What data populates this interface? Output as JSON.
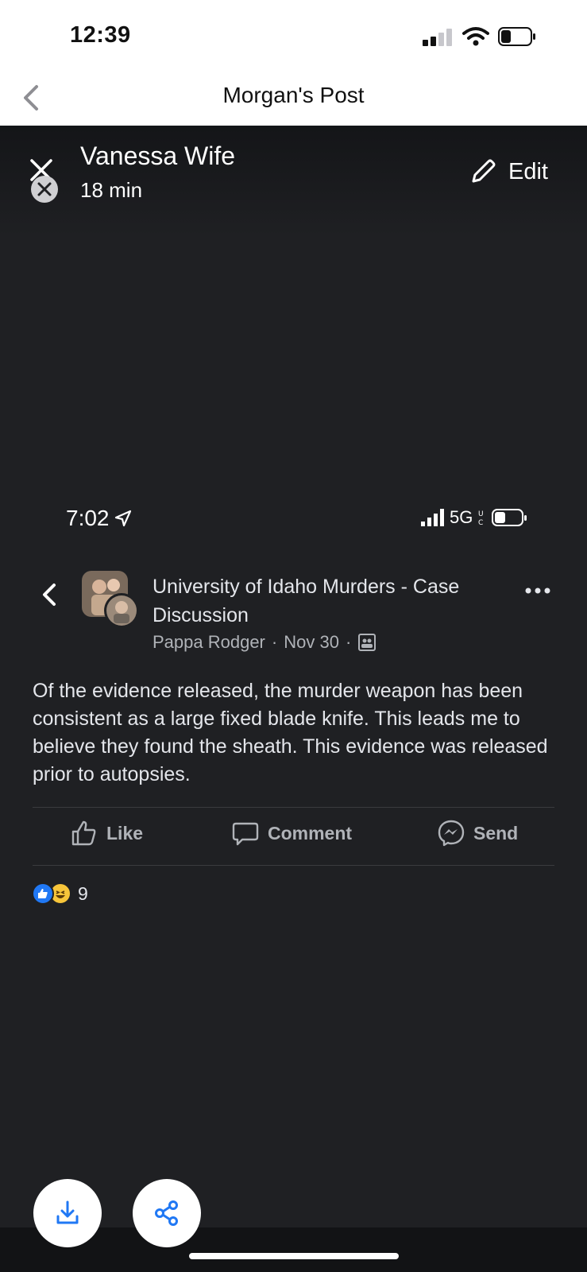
{
  "status_bar": {
    "time": "12:39"
  },
  "nav": {
    "title": "Morgan's Post"
  },
  "story": {
    "author": "Vanessa Wife",
    "time": "18 min",
    "edit_label": "Edit"
  },
  "screenshot": {
    "status": {
      "time": "7:02",
      "network": "5G"
    },
    "post": {
      "group_name": "University of Idaho Murders - Case Discussion",
      "author": "Pappa Rodger",
      "date": "Nov 30",
      "separator": "·",
      "body": "Of the evidence released, the murder weapon has been consistent as a large fixed blade knife.  This leads me to believe they found the sheath.  This evidence was released prior to autopsies.",
      "actions": {
        "like": "Like",
        "comment": "Comment",
        "send": "Send"
      },
      "reaction_count": "9"
    }
  },
  "colors": {
    "accent": "#2078f4",
    "background": "#1f2023",
    "text": "#e4e6eb",
    "muted": "#b0b3b8"
  }
}
